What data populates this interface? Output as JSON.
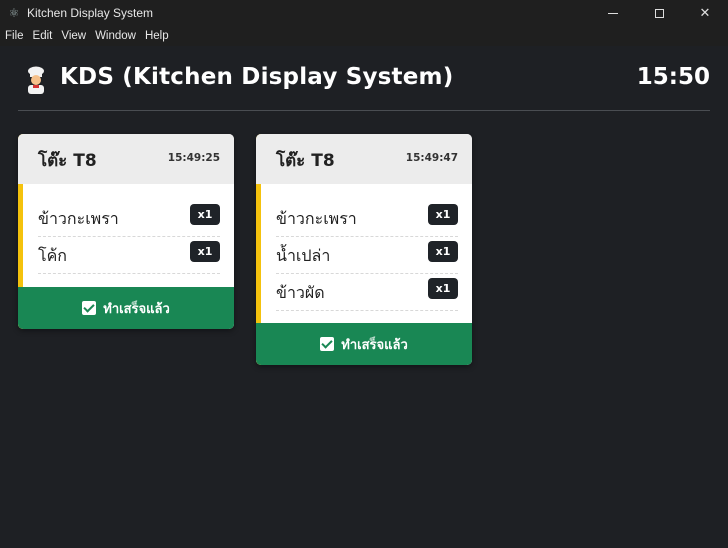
{
  "window": {
    "title": "Kitchen Display System"
  },
  "menu": [
    "File",
    "Edit",
    "View",
    "Window",
    "Help"
  ],
  "header": {
    "title": "KDS (Kitchen Display System)",
    "clock": "15:50"
  },
  "orders": [
    {
      "table": "โต๊ะ T8",
      "time": "15:49:25",
      "items": [
        {
          "name": "ข้าวกะเพรา",
          "qty": "x1"
        },
        {
          "name": "โค้ก",
          "qty": "x1"
        }
      ],
      "done_label": "ทำเสร็จแล้ว"
    },
    {
      "table": "โต๊ะ T8",
      "time": "15:49:47",
      "items": [
        {
          "name": "ข้าวกะเพรา",
          "qty": "x1"
        },
        {
          "name": "น้ำเปล่า",
          "qty": "x1"
        },
        {
          "name": "ข้าวผัด",
          "qty": "x1"
        }
      ],
      "done_label": "ทำเสร็จแล้ว"
    }
  ],
  "colors": {
    "accent": "#f4c20d",
    "done": "#198754",
    "background": "#1e2024"
  },
  "icons": {
    "chef": "chef-emoji-icon",
    "check": "check-box-icon"
  }
}
